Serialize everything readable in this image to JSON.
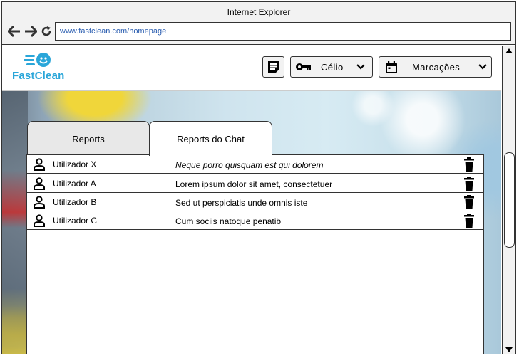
{
  "window": {
    "title": "Internet Explorer"
  },
  "browser": {
    "url": "www.fastclean.com/homepage",
    "back_icon": "back-arrow-icon",
    "forward_icon": "forward-arrow-icon",
    "reload_icon": "reload-icon"
  },
  "app": {
    "logo_text": "FastClean",
    "brand_color": "#2aa6d9",
    "header": {
      "notes_icon": "notes-icon",
      "user_label": "Célio",
      "user_icon": "key-icon",
      "appointments_label": "Marcações",
      "appointments_icon": "calendar-icon"
    }
  },
  "tabs": [
    {
      "label": "Reports",
      "active": false
    },
    {
      "label": "Reports do Chat",
      "active": true
    }
  ],
  "reports": [
    {
      "user": "Utilizador X",
      "message": "Neque porro quisquam est qui dolorem",
      "italic": true
    },
    {
      "user": "Utilizador A",
      "message": "Lorem ipsum dolor sit amet, consectetuer",
      "italic": false
    },
    {
      "user": "Utilizador B",
      "message": "Sed ut perspiciatis unde omnis iste",
      "italic": false
    },
    {
      "user": "Utilizador C",
      "message": "Cum sociis natoque penatib",
      "italic": false
    }
  ]
}
